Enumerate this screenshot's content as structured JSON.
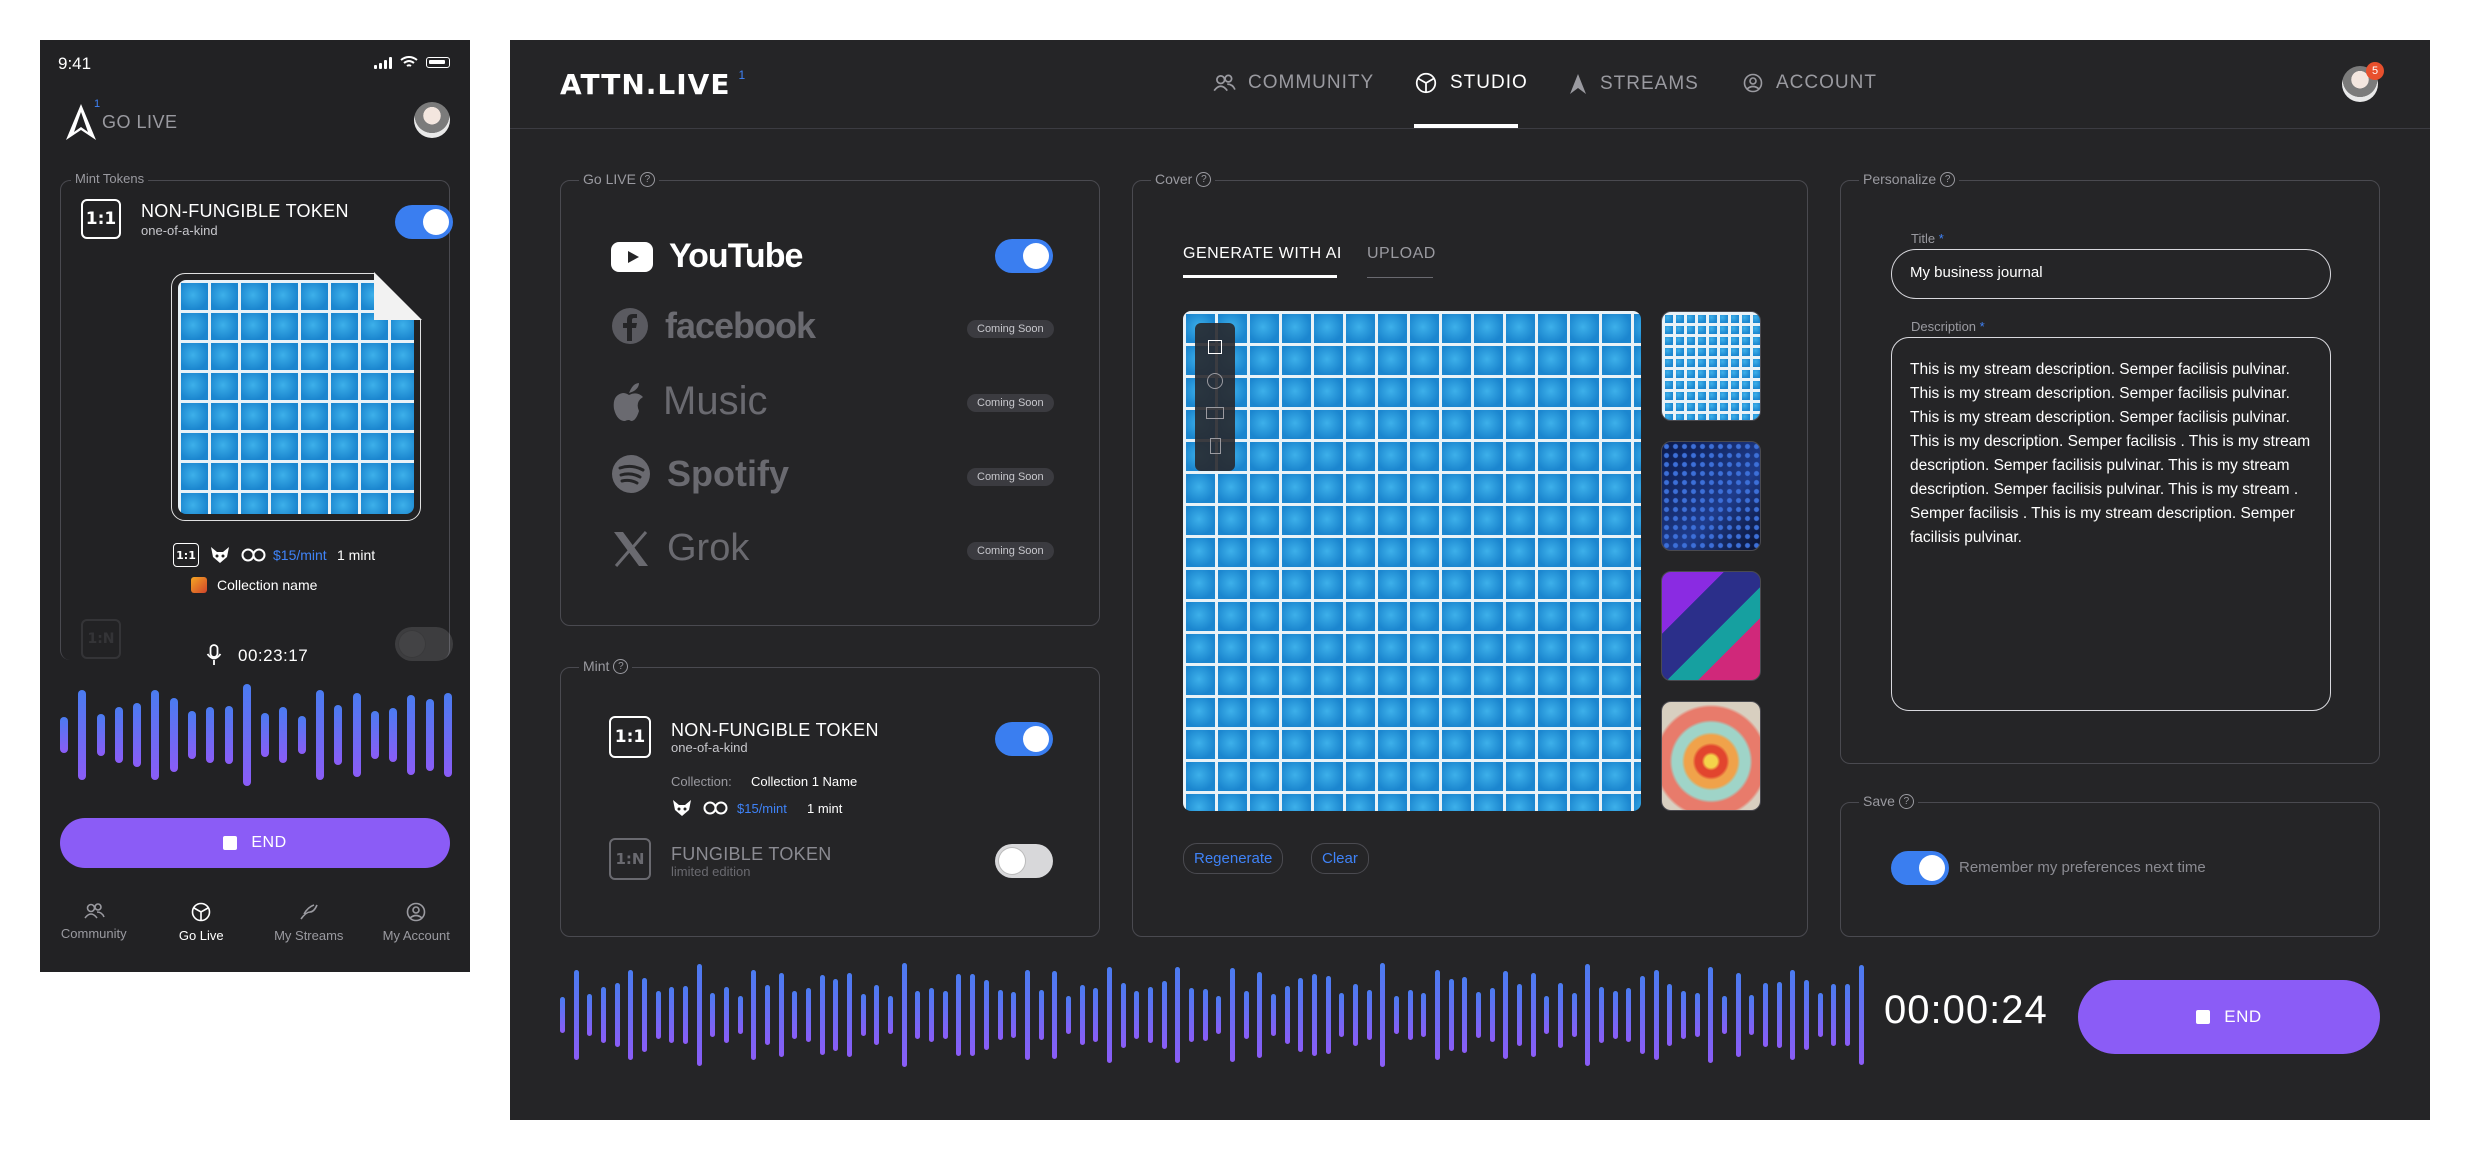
{
  "phone": {
    "time": "9:41",
    "go_live": "GO LIVE",
    "logo_sup": "1",
    "mint_label": "Mint Tokens",
    "nft": {
      "badge": "1:1",
      "title": "NON-FUNGIBLE TOKEN",
      "subtitle": "one-of-a-kind",
      "enabled": true
    },
    "meta": {
      "badge": "1:1",
      "price": "$15/mint",
      "count": "1 mint",
      "collection": "Collection name"
    },
    "hidden_badge": "1:N",
    "timer": "00:23:17",
    "end_label": "END",
    "tabs": [
      {
        "label": "Community",
        "icon": "community-icon",
        "active": false
      },
      {
        "label": "Go Live",
        "icon": "globe-icon",
        "active": true
      },
      {
        "label": "My Streams",
        "icon": "streams-icon",
        "active": false
      },
      {
        "label": "My Account",
        "icon": "account-icon",
        "active": false
      }
    ]
  },
  "desktop": {
    "brand": "ATTN.LIVE",
    "brand_sup": "1",
    "nav": [
      {
        "label": "COMMUNITY",
        "icon": "community-icon",
        "active": false
      },
      {
        "label": "STUDIO",
        "icon": "globe-icon",
        "active": true
      },
      {
        "label": "STREAMS",
        "icon": "streams-icon",
        "active": false
      },
      {
        "label": "ACCOUNT",
        "icon": "account-icon",
        "active": false
      }
    ],
    "notification_count": "5",
    "golive": {
      "label": "Go LIVE",
      "services": [
        {
          "name": "YouTube",
          "icon": "youtube-icon",
          "enabled": true,
          "status": ""
        },
        {
          "name": "facebook",
          "icon": "facebook-icon",
          "enabled": false,
          "status": "Coming Soon"
        },
        {
          "name": "Music",
          "icon": "apple-icon",
          "enabled": false,
          "status": "Coming Soon"
        },
        {
          "name": "Spotify",
          "icon": "spotify-icon",
          "enabled": false,
          "status": "Coming Soon"
        },
        {
          "name": "Grok",
          "icon": "x-icon",
          "enabled": false,
          "status": "Coming Soon"
        }
      ]
    },
    "mint": {
      "label": "Mint",
      "nft": {
        "badge": "1:1",
        "title": "NON-FUNGIBLE TOKEN",
        "subtitle": "one-of-a-kind",
        "enabled": true,
        "collection_label": "Collection:",
        "collection_value": "Collection 1 Name",
        "price": "$15/mint",
        "count": "1 mint"
      },
      "ft": {
        "badge": "1:N",
        "title": "FUNGIBLE TOKEN",
        "subtitle": "limited edition",
        "enabled": false
      }
    },
    "cover": {
      "label": "Cover",
      "tabs": [
        {
          "label": "GENERATE WITH AI",
          "active": true
        },
        {
          "label": "UPLOAD",
          "active": false
        }
      ],
      "regenerate": "Regenerate",
      "clear": "Clear",
      "tools": [
        "square-tool-icon",
        "circle-tool-icon",
        "rect-tool-icon",
        "portrait-tool-icon"
      ]
    },
    "personalize": {
      "label": "Personalize",
      "title_label": "Title",
      "title_value": "My business journal",
      "desc_label": "Description",
      "desc_value": "This is my stream description. Semper facilisis pulvinar.  This is my stream description. Semper facilisis pulvinar. This is my stream description. Semper facilisis pulvinar.  This is my  description. Semper facilisis . This is my stream description. Semper facilisis pulvinar.  This is my stream description. Semper facilisis pulvinar. This is my stream . Semper facilisis .  This is my stream description. Semper facilisis pulvinar."
    },
    "save": {
      "label": "Save",
      "remember": "Remember my preferences next time",
      "enabled": true
    },
    "timer": "00:00:24",
    "end_label": "END"
  },
  "colors": {
    "accent": "#8b5cf6",
    "toggle_on": "#3f83f8",
    "panel_bg": "#252527",
    "border": "#4a4a50"
  }
}
